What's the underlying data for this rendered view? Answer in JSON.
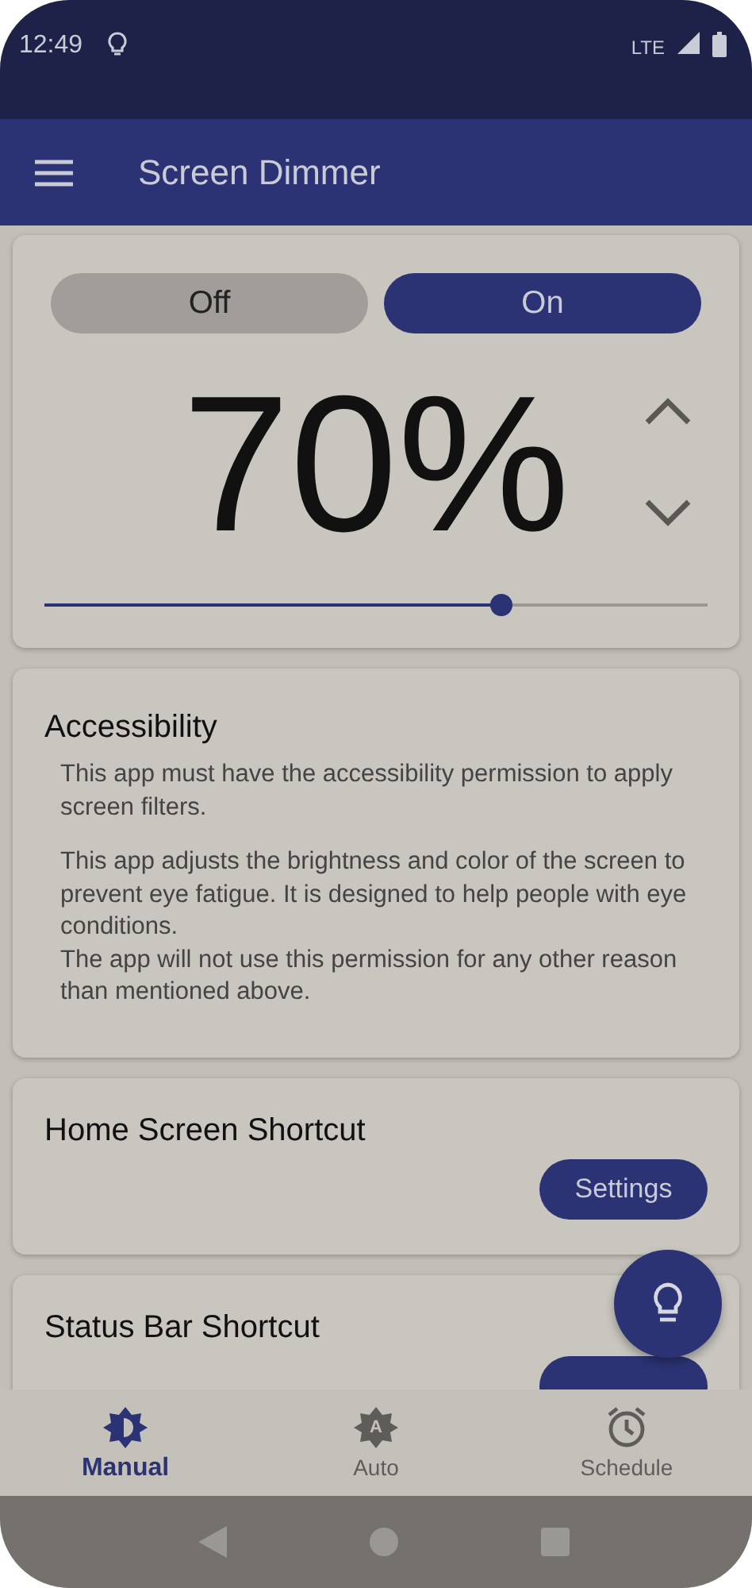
{
  "status_bar": {
    "time": "12:49",
    "network": "LTE"
  },
  "app_bar": {
    "title": "Screen Dimmer"
  },
  "power": {
    "options": [
      {
        "label": "Off",
        "selected": false
      },
      {
        "label": "On",
        "selected": true
      }
    ],
    "percent": "70%",
    "level": 0.69
  },
  "accessibility": {
    "title": "Accessibility",
    "paragraphs": [
      "This app must have the accessibility permission to apply screen filters.",
      "This app adjusts the brightness and color of the screen to prevent eye fatigue. It is designed to help people with eye conditions.\nThe app will not use this permission for any other reason than mentioned above."
    ]
  },
  "shortcuts": [
    {
      "title": "Home Screen Shortcut",
      "button": "Settings"
    },
    {
      "title": "Status Bar Shortcut",
      "has_button": true
    }
  ],
  "bottom_nav": [
    {
      "label": "Manual",
      "kind": "manual",
      "selected": true
    },
    {
      "label": "Auto",
      "kind": "auto",
      "icon_letter": "A",
      "selected": false
    },
    {
      "label": "Schedule",
      "kind": "schedule",
      "selected": false
    }
  ]
}
